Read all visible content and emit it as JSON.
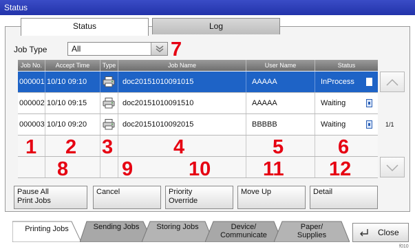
{
  "title": "Status",
  "tabs": {
    "status": "Status",
    "log": "Log"
  },
  "filter": {
    "label": "Job Type",
    "value": "All"
  },
  "table": {
    "headers": [
      "Job No.",
      "Accept Time",
      "Type",
      "Job Name",
      "User Name",
      "Status"
    ],
    "rows": [
      {
        "job_no": "000001",
        "accept_time": "10/10 09:10",
        "job_name": "doc20151010091015",
        "user_name": "AAAAA",
        "status": "InProcess"
      },
      {
        "job_no": "000002",
        "accept_time": "10/10 09:15",
        "job_name": "doc20151010091510",
        "user_name": "AAAAA",
        "status": "Waiting"
      },
      {
        "job_no": "000003",
        "accept_time": "10/10 09:20",
        "job_name": "doc20151010092015",
        "user_name": "BBBBB",
        "status": "Waiting"
      }
    ]
  },
  "pagination": "1/1",
  "callouts": [
    "1",
    "2",
    "3",
    "4",
    "5",
    "6",
    "7",
    "8",
    "9",
    "10",
    "11",
    "12"
  ],
  "actions": {
    "pause_all_line1": "Pause All",
    "pause_all_line2": "Print Jobs",
    "cancel": "Cancel",
    "priority_line1": "Priority",
    "priority_line2": "Override",
    "move_up": "Move Up",
    "detail": "Detail"
  },
  "bottom_tabs": {
    "printing": "Printing Jobs",
    "sending": "Sending Jobs",
    "storing": "Storing Jobs",
    "device_line1": "Device/",
    "device_line2": "Communicate",
    "paper_line1": "Paper/",
    "paper_line2": "Supplies"
  },
  "close": "Close",
  "figure_code": "f010",
  "colors": {
    "title_bar": "#2a3cb8",
    "selected_row": "#1e63c6",
    "callout": "#e60012"
  },
  "icons": [
    "printer-icon",
    "status-icon",
    "chevron-down-icon",
    "chevron-up-icon",
    "enter-icon"
  ]
}
